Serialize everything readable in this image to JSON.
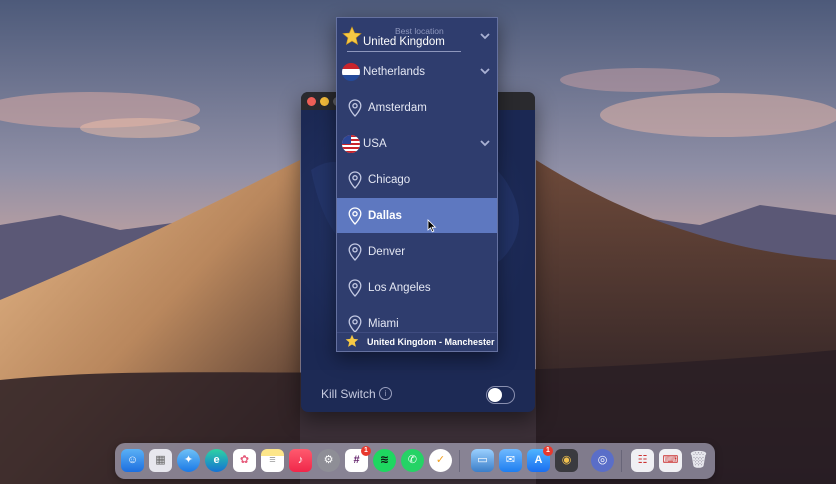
{
  "dropdown": {
    "best_location": {
      "caption": "Best location",
      "name": "United Kingdom"
    },
    "countries": [
      {
        "name": "Netherlands",
        "flag": "netherlands-flag-icon",
        "cities": [
          "Amsterdam"
        ]
      },
      {
        "name": "USA",
        "flag": "usa-flag-icon",
        "cities": [
          "Chicago",
          "Dallas",
          "Denver",
          "Los Angeles",
          "Miami"
        ]
      }
    ],
    "selected_city": "Dallas",
    "current_connection": "United Kingdom - Manchester"
  },
  "app": {
    "kill_switch_label": "Kill Switch",
    "kill_switch_on": false
  },
  "dock": {
    "apps": [
      "Finder",
      "Launchpad",
      "Safari",
      "Microsoft Edge",
      "Photos",
      "Notes",
      "Music",
      "System Preferences",
      "Slack",
      "Spotify",
      "WhatsApp",
      "Tasks",
      "Preview",
      "Mail",
      "App Store",
      "Photo Booth",
      "VPN",
      "Reminders",
      "Keyboard",
      "Trash"
    ],
    "slack_badge": "1",
    "appstore_badge": "1"
  },
  "colors": {
    "panel_bg": "#2f3d6e",
    "selected_bg": "#5e78c0",
    "window_bg": "#1d2a55"
  }
}
